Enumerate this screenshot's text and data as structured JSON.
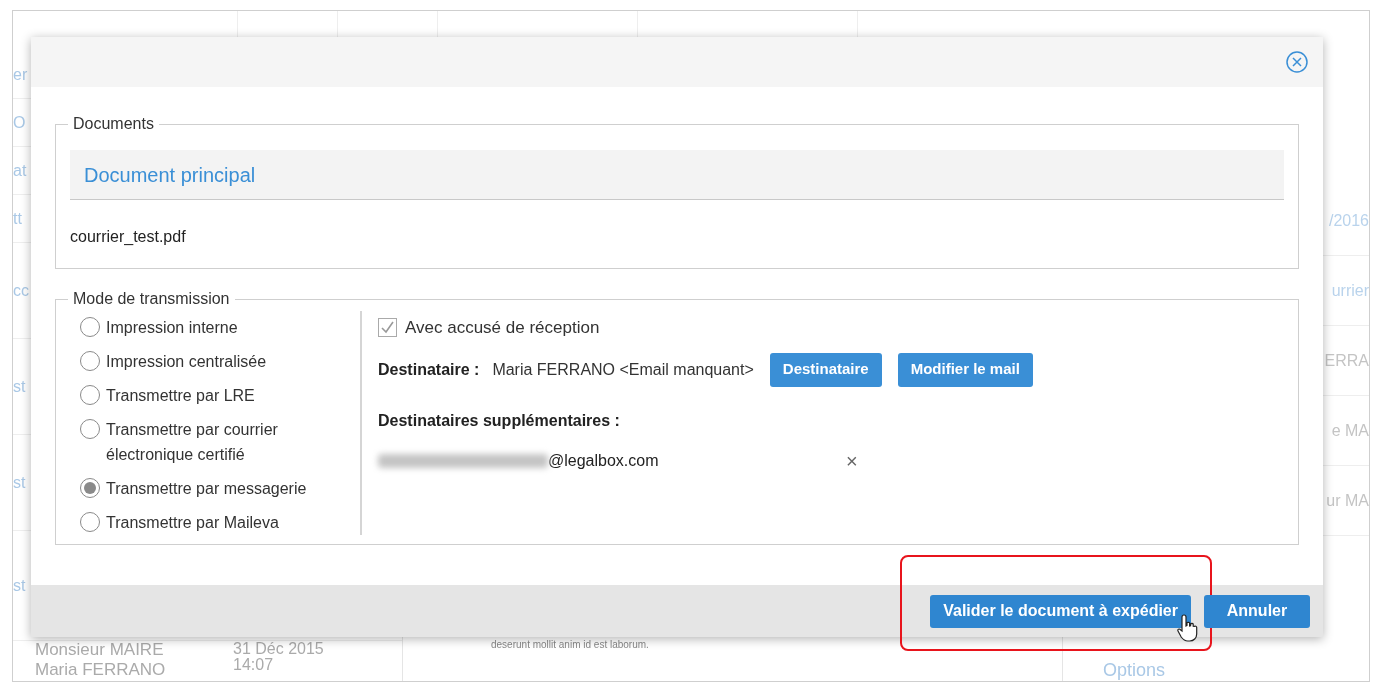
{
  "background": {
    "left_fragments": [
      "er",
      "O",
      "at",
      "tt",
      "cc",
      "st",
      "st",
      "st"
    ],
    "list_rows": [
      {
        "name": "Monsieur MAIRE",
        "date": "31 Déc 2015",
        "time": "14:07"
      },
      {
        "name": "Maria FERRANO"
      }
    ],
    "preview_text": "deserunt mollit anim id est laborum.",
    "right_fragments": [
      {
        "text": "/2016",
        "kind": "link"
      },
      {
        "text": "urrier",
        "kind": "link"
      },
      {
        "text": "ERRA",
        "kind": "text"
      },
      {
        "text": "e MA",
        "kind": "text"
      },
      {
        "text": "ur MA",
        "kind": "text"
      }
    ],
    "options_link": "Options"
  },
  "dialog": {
    "documents": {
      "legend": "Documents",
      "heading": "Document principal",
      "file": "courrier_test.pdf"
    },
    "transmission": {
      "legend": "Mode de transmission",
      "modes": [
        {
          "label": "Impression interne",
          "selected": false
        },
        {
          "label": "Impression centralisée",
          "selected": false
        },
        {
          "label": "Transmettre par LRE",
          "selected": false
        },
        {
          "label": "Transmettre par courrier électronique certifié",
          "selected": false
        },
        {
          "label": "Transmettre par messagerie",
          "selected": true
        },
        {
          "label": "Transmettre par Maileva",
          "selected": false
        }
      ],
      "receipt": {
        "label": "Avec accusé de réception",
        "checked": true
      },
      "recipient_label": "Destinataire :",
      "recipient": "Maria FERRANO <Email manquant>",
      "recipient_buttons": [
        "Destinataire",
        "Modifier le mail"
      ],
      "extra_label": "Destinataires supplémentaires :",
      "extra_recipients": [
        {
          "email": "@legalbox.com",
          "remove": "×"
        }
      ]
    },
    "buttons": [
      {
        "label": "Valider le document à expédier",
        "highlighted": true
      },
      {
        "label": "Annuler",
        "highlighted": false
      }
    ]
  }
}
